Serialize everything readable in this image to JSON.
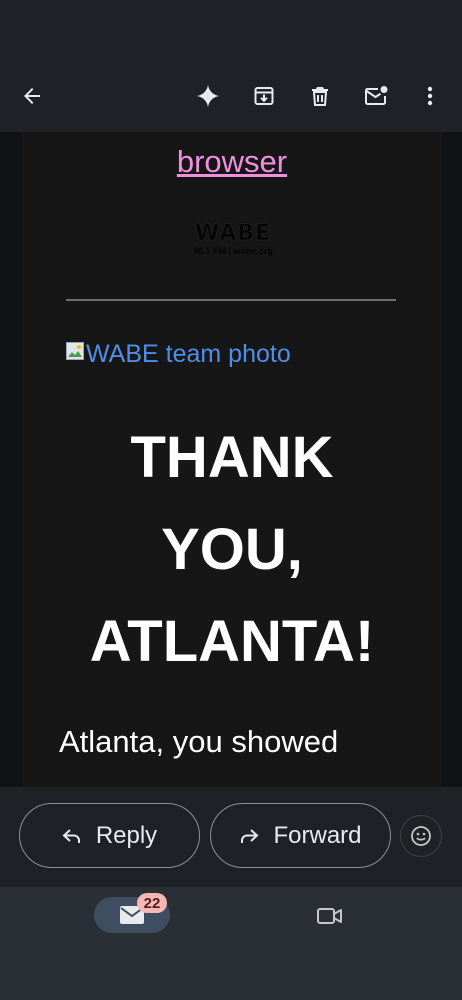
{
  "topbar": {
    "icons": [
      "back-arrow-icon",
      "sparkle-icon",
      "archive-icon",
      "delete-icon",
      "mark-unread-icon",
      "more-vert-icon"
    ]
  },
  "email": {
    "browser_link": "browser",
    "logo": {
      "mark": "WABE",
      "subtitle": "90.1 FM | wabe.org"
    },
    "image_alt": "WABE team photo",
    "headline": [
      "THANK",
      "YOU,",
      "ATLANTA!"
    ],
    "body_text": "Atlanta, you showed"
  },
  "actions": {
    "reply_label": "Reply",
    "forward_label": "Forward"
  },
  "navbar": {
    "mail_badge": "22"
  },
  "colors": {
    "background": "#1e2227",
    "email_bg": "#161616",
    "link_pink": "#f08ee0",
    "alt_blue": "#4f8ee8",
    "badge": "#f4b9b4",
    "nav_pill": "#3e4d5f"
  }
}
